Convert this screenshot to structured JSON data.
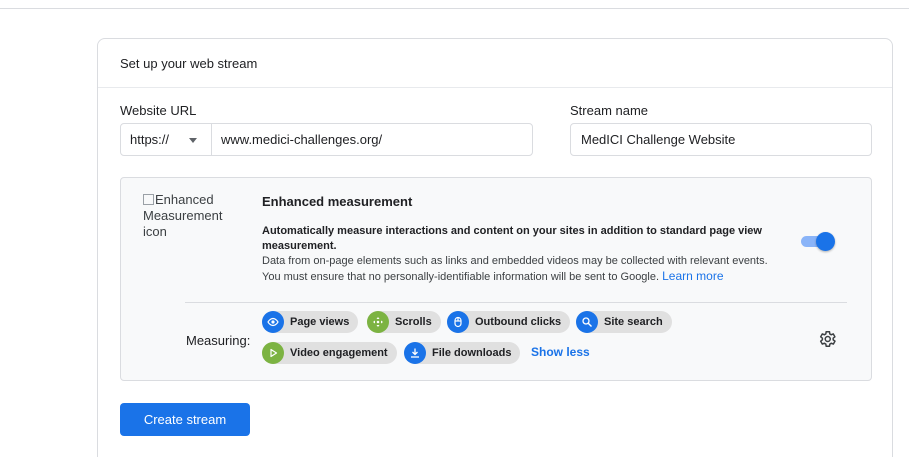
{
  "card": {
    "title": "Set up your web stream"
  },
  "website_url": {
    "label": "Website URL",
    "protocol": "https://",
    "value": "www.medici-challenges.org/"
  },
  "stream_name": {
    "label": "Stream name",
    "value": "MedICI Challenge Website"
  },
  "enhanced": {
    "icon_alt": "Enhanced Measurement icon",
    "title": "Enhanced measurement",
    "desc_bold": "Automatically measure interactions and content on your sites in addition to standard page view measurement.",
    "desc_line2": "Data from on-page elements such as links and embedded videos may be collected with relevant events.",
    "desc_line3": "You must ensure that no personally-identifiable information will be sent to Google.",
    "learn_more": "Learn more",
    "enabled": true,
    "measuring_label": "Measuring:",
    "chips": [
      {
        "label": "Page views",
        "icon": "eye-icon",
        "color": "#1a73e8"
      },
      {
        "label": "Scrolls",
        "icon": "scroll-arrows-icon",
        "color": "#7cb342"
      },
      {
        "label": "Outbound clicks",
        "icon": "mouse-icon",
        "color": "#1a73e8"
      },
      {
        "label": "Site search",
        "icon": "search-icon",
        "color": "#1a73e8"
      },
      {
        "label": "Video engagement",
        "icon": "play-icon",
        "color": "#7cb342"
      },
      {
        "label": "File downloads",
        "icon": "download-icon",
        "color": "#1a73e8"
      }
    ],
    "show_less": "Show less"
  },
  "create_button": "Create stream",
  "colors": {
    "accent": "#1a73e8",
    "accent_light": "#8ab4f8",
    "green": "#7cb342",
    "chip_bg": "#e0e0e0"
  }
}
